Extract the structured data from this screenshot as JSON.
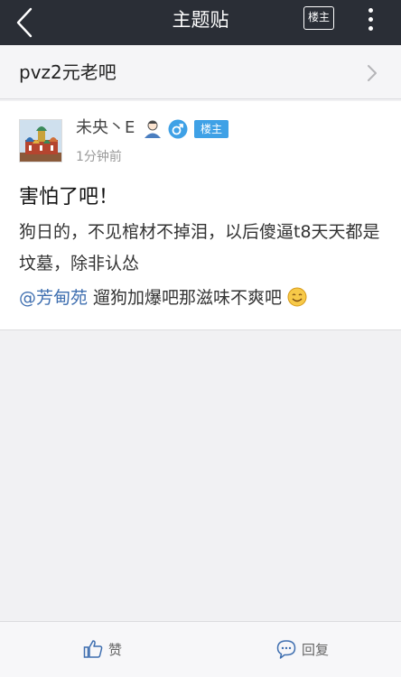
{
  "header": {
    "title": "主题贴",
    "op_only_button": "楼主"
  },
  "forum": {
    "name": "pvz2元老吧"
  },
  "post": {
    "username": "未央丶E",
    "badge": "楼主",
    "timestamp": "1分钟前",
    "title": "害怕了吧！",
    "body": "狗日的，不见棺材不掉泪，以后傻逼t8天天都是坟墓，除非认怂",
    "mention": "@芳甸苑",
    "mention_text": " 遛狗加爆吧那滋味不爽吧"
  },
  "bottombar": {
    "like_label": "赞",
    "reply_label": "回复"
  },
  "colors": {
    "header_bg": "#2a2e36",
    "accent_blue": "#3fa1e6",
    "mention_blue": "#3f6fb0"
  }
}
